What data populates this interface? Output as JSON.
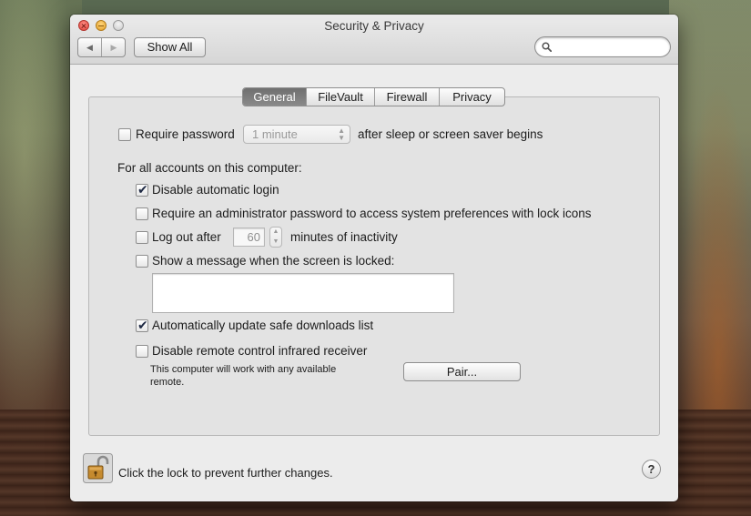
{
  "window": {
    "title": "Security & Privacy"
  },
  "toolbar": {
    "back_icon": "triangle-left-icon",
    "forward_icon": "triangle-right-icon",
    "show_all_label": "Show All",
    "search": {
      "placeholder": "",
      "value": ""
    }
  },
  "tabs": [
    {
      "label": "General",
      "selected": true
    },
    {
      "label": "FileVault",
      "selected": false
    },
    {
      "label": "Firewall",
      "selected": false
    },
    {
      "label": "Privacy",
      "selected": false
    }
  ],
  "general": {
    "require_password": {
      "label": "Require password",
      "checked": false,
      "delay_value": "1 minute",
      "suffix": "after sleep or screen saver begins"
    },
    "all_accounts_heading": "For all accounts on this computer:",
    "disable_auto_login": {
      "label": "Disable automatic login",
      "checked": true
    },
    "require_admin_password": {
      "label": "Require an administrator password to access system preferences with lock icons",
      "checked": false
    },
    "log_out_after": {
      "label": "Log out after",
      "checked": false,
      "minutes": "60",
      "suffix": "minutes of inactivity"
    },
    "show_message": {
      "label": "Show a message when the screen is locked:",
      "checked": false,
      "message": ""
    },
    "auto_update_safe_downloads": {
      "label": "Automatically update safe downloads list",
      "checked": true
    },
    "disable_remote_ir": {
      "label": "Disable remote control infrared receiver",
      "checked": false,
      "note_line1": "This computer will work with any available",
      "note_line2": "remote."
    },
    "pair_button_label": "Pair..."
  },
  "footer": {
    "lock_icon": "padlock-open-icon",
    "lock_message": "Click the lock to prevent further changes.",
    "help_label": "?"
  },
  "colors": {
    "window_bg": "#ececec",
    "tab_selected_bg": "#7d7d7d",
    "check_color": "#1f2a44"
  }
}
